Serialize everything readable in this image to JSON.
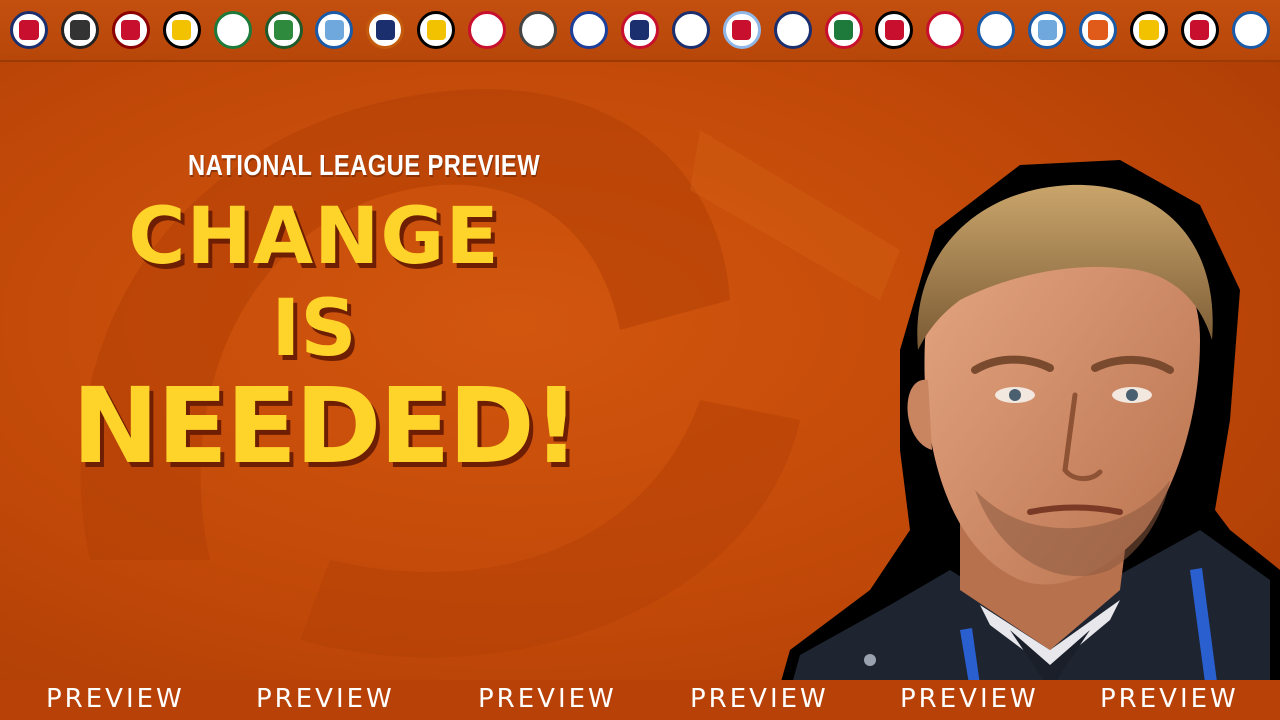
{
  "kicker": "NATIONAL LEAGUE PREVIEW",
  "headline": {
    "line1": "CHANGE",
    "line2": "IS",
    "line3": "NEEDED!"
  },
  "footer": {
    "words": [
      "PREVIEW",
      "PREVIEW",
      "PREVIEW",
      "PREVIEW",
      "PREVIEW",
      "PREVIEW"
    ]
  },
  "crests": [
    {
      "name": "crest-1",
      "ring": "#1b2f6e",
      "fill": "#c8102e"
    },
    {
      "name": "crest-2",
      "ring": "#222222",
      "fill": "#333333"
    },
    {
      "name": "crest-3",
      "ring": "#8b0000",
      "fill": "#c8102e"
    },
    {
      "name": "crest-4",
      "ring": "#000000",
      "fill": "#f2c200"
    },
    {
      "name": "crest-5",
      "ring": "#1e7a3a",
      "fill": "#ffffff"
    },
    {
      "name": "crest-6",
      "ring": "#1e5a2a",
      "fill": "#2e8b3e"
    },
    {
      "name": "crest-7",
      "ring": "#1b5aa6",
      "fill": "#6fa8dc"
    },
    {
      "name": "crest-8",
      "ring": "#c35a0c",
      "fill": "#1b2f6e"
    },
    {
      "name": "crest-9",
      "ring": "#000000",
      "fill": "#f2c200"
    },
    {
      "name": "crest-10",
      "ring": "#c8102e",
      "fill": "#ffffff"
    },
    {
      "name": "crest-11",
      "ring": "#444444",
      "fill": "#ffffff"
    },
    {
      "name": "crest-12",
      "ring": "#1b3f9a",
      "fill": "#ffffff"
    },
    {
      "name": "crest-13",
      "ring": "#c8102e",
      "fill": "#1b2f6e"
    },
    {
      "name": "crest-14",
      "ring": "#1b2f6e",
      "fill": "#ffffff"
    },
    {
      "name": "crest-15",
      "ring": "#8fb8e8",
      "fill": "#c8102e"
    },
    {
      "name": "crest-16",
      "ring": "#1b2f6e",
      "fill": "#ffffff"
    },
    {
      "name": "crest-17",
      "ring": "#c8102e",
      "fill": "#1e7a3a"
    },
    {
      "name": "crest-18",
      "ring": "#000000",
      "fill": "#c8102e"
    },
    {
      "name": "crest-19",
      "ring": "#c8102e",
      "fill": "#ffffff"
    },
    {
      "name": "crest-20",
      "ring": "#1b5aa6",
      "fill": "#ffffff"
    },
    {
      "name": "crest-21",
      "ring": "#1b5aa6",
      "fill": "#6fa8dc"
    },
    {
      "name": "crest-22",
      "ring": "#1b5aa6",
      "fill": "#e05a1a"
    },
    {
      "name": "crest-23",
      "ring": "#000000",
      "fill": "#f2c200"
    },
    {
      "name": "crest-24",
      "ring": "#000000",
      "fill": "#c8102e"
    },
    {
      "name": "crest-25",
      "ring": "#1b5aa6",
      "fill": "#ffffff"
    }
  ],
  "colors": {
    "headline": "#ffd42a",
    "headline_shadow": "#6e1e02",
    "background": "#c84a0c",
    "strip": "#b84107"
  }
}
